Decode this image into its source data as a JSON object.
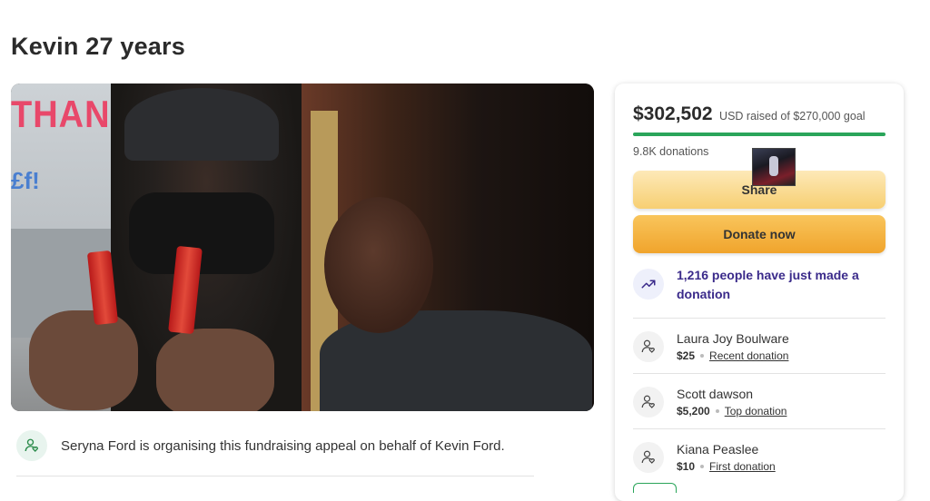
{
  "page": {
    "title": "Kevin 27 years"
  },
  "hero": {
    "wall_text_1": "THANKFUL",
    "wall_text_2": "£f!"
  },
  "organiser": {
    "text": "Seryna Ford is organising this fundraising appeal on behalf of Kevin Ford.",
    "icon": "user-heart-icon"
  },
  "donation_card": {
    "amount_raised": "$302,502",
    "goal_text": "USD raised of $270,000 goal",
    "progress_fraction": 1.0,
    "donations_count": "9.8K donations",
    "share_label": "Share",
    "donate_label": "Donate now",
    "recent_activity": "1,216 people have just made a donation",
    "recent_icon": "trending-up-icon",
    "donors": [
      {
        "name": "Laura Joy Boulware",
        "amount": "$25",
        "tag": "Recent donation"
      },
      {
        "name": "Scott dawson",
        "amount": "$5,200",
        "tag": "Top donation"
      },
      {
        "name": "Kiana Peaslee",
        "amount": "$10",
        "tag": "First donation"
      }
    ]
  },
  "colors": {
    "progress": "#2aa55a",
    "donate_button": "#f0a42c",
    "share_button": "#f7cf72",
    "recent_text": "#3a2a8a"
  }
}
